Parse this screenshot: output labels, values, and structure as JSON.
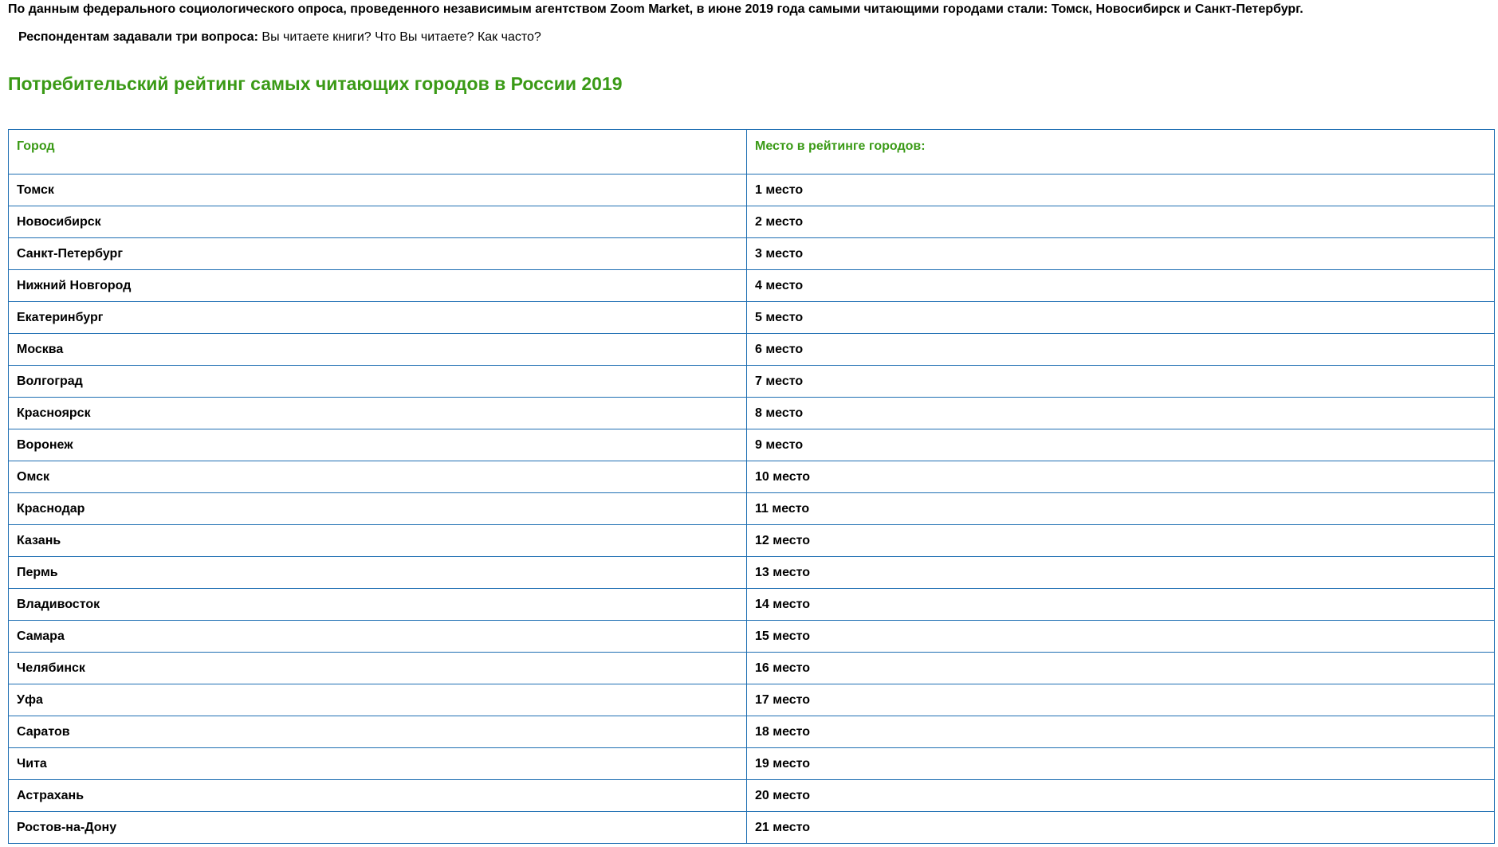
{
  "intro": "По данным федерального социологического опроса, проведенного независимым агентством Zoom Market, в июне 2019 года самыми читающими городами стали: Томск, Новосибирск и Санкт-Петербург.",
  "questions": {
    "label": "Респондентам задавали три вопроса:",
    "text": " Вы читаете книги? Что Вы читаете? Как часто?"
  },
  "title": "Потребительский рейтинг самых читающих городов в России 2019",
  "table": {
    "headers": [
      "Город",
      "Место в рейтинге городов:"
    ],
    "rows": [
      {
        "city": "Томск",
        "place": "1 место"
      },
      {
        "city": "Новосибирск",
        "place": "2 место"
      },
      {
        "city": "Санкт-Петербург",
        "place": "3 место"
      },
      {
        "city": "Нижний Новгород",
        "place": "4 место"
      },
      {
        "city": "Екатеринбург",
        "place": "5 место"
      },
      {
        "city": "Москва",
        "place": "6 место"
      },
      {
        "city": "Волгоград",
        "place": "7 место"
      },
      {
        "city": "Красноярск",
        "place": "8 место"
      },
      {
        "city": "Воронеж",
        "place": "9 место"
      },
      {
        "city": "Омск",
        "place": "10 место"
      },
      {
        "city": "Краснодар",
        "place": "11 место"
      },
      {
        "city": "Казань",
        "place": "12 место"
      },
      {
        "city": "Пермь",
        "place": "13 место"
      },
      {
        "city": "Владивосток",
        "place": "14 место"
      },
      {
        "city": "Самара",
        "place": "15 место"
      },
      {
        "city": "Челябинск",
        "place": "16 место"
      },
      {
        "city": "Уфа",
        "place": "17 место"
      },
      {
        "city": "Саратов",
        "place": "18 место"
      },
      {
        "city": "Чита",
        "place": "19 место"
      },
      {
        "city": "Астрахань",
        "place": "20 место"
      },
      {
        "city": "Ростов-на-Дону",
        "place": "21 место"
      }
    ]
  },
  "colors": {
    "accent_green": "#3a9a16",
    "border_blue": "#1f6fb3"
  }
}
